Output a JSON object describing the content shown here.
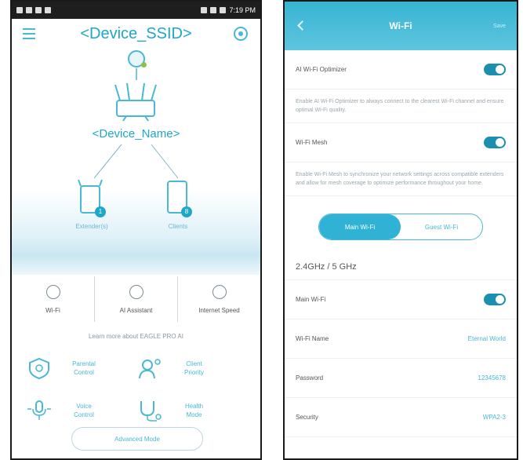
{
  "status_bar": {
    "time": "7:19 PM"
  },
  "home": {
    "ssid": "<Device_SSID>",
    "device_name": "<Device_Name>",
    "nodes": [
      {
        "label": "Extender(s)",
        "count": "1"
      },
      {
        "label": "Clients",
        "count": "8"
      }
    ],
    "quick_actions": [
      {
        "label": "Wi-Fi",
        "icon": "wifi-icon"
      },
      {
        "label": "AI Assistant",
        "icon": "assistant-icon"
      },
      {
        "label": "Internet Speed",
        "icon": "speed-icon"
      }
    ],
    "learn_more": "Learn more about EAGLE PRO AI",
    "features": [
      {
        "label_1": "Parental",
        "label_2": "Control",
        "icon": "shield-icon"
      },
      {
        "label_1": "Client",
        "label_2": "Priority",
        "icon": "user-priority-icon"
      },
      {
        "label_1": "Voice",
        "label_2": "Control",
        "icon": "microphone-icon"
      },
      {
        "label_1": "Health",
        "label_2": "Mode",
        "icon": "stethoscope-icon"
      }
    ],
    "advanced_button": "Advanced Mode"
  },
  "wifi_settings": {
    "title": "Wi-Fi",
    "save": "Save",
    "ai_optimizer": {
      "label": "AI Wi-Fi Optimizer",
      "desc": "Enable AI Wi-Fi Optimizer to always connect to the clearest Wi-Fi channel and ensure optimal Wi-Fi quality."
    },
    "mesh": {
      "label": "Wi-Fi Mesh",
      "desc": "Enable Wi-Fi Mesh to synchronize your network settings across compatible extenders and allow for mesh coverage to optimize performance throughout your home."
    },
    "tabs": [
      "Main Wi-Fi",
      "Guest Wi-Fi"
    ],
    "band_title": "2.4GHz / 5 GHz",
    "rows": [
      {
        "label": "Main Wi-Fi",
        "toggle": true
      },
      {
        "label": "Wi-Fi Name",
        "value": "Eternal World"
      },
      {
        "label": "Password",
        "value": "12345678"
      },
      {
        "label": "Security",
        "value": "WPA2-3"
      }
    ]
  }
}
